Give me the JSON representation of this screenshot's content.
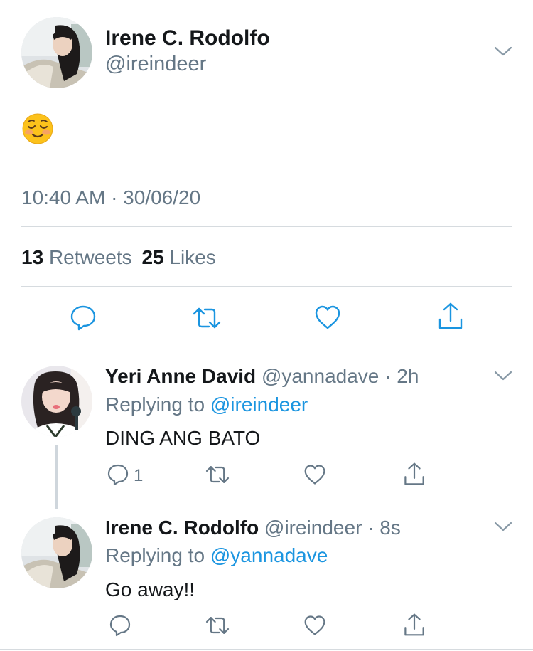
{
  "main_tweet": {
    "author_name": "Irene C. Rodolfo",
    "author_handle": "@ireindeer",
    "content_emoji": "☺️",
    "timestamp": "10:40 AM · 30/06/20",
    "retweets_count": "13",
    "retweets_label": "Retweets",
    "likes_count": "25",
    "likes_label": "Likes"
  },
  "replies": [
    {
      "author_name": "Yeri Anne David",
      "author_handle": "@yannadave",
      "time": "· 2h",
      "replying_prefix": "Replying to",
      "replying_to": "@ireindeer",
      "text": "DING ANG BATO",
      "reply_count": "1"
    },
    {
      "author_name": "Irene C. Rodolfo",
      "author_handle": "@ireindeer",
      "time": "· 8s",
      "replying_prefix": "Replying to",
      "replying_to": "@yannadave",
      "text": "Go away!!"
    }
  ],
  "colors": {
    "text": "#14171a",
    "secondary": "#657786",
    "link": "#1b95e0",
    "divider": "#d6dbdf"
  },
  "icons": [
    "chevron-down-icon",
    "reply-icon",
    "retweet-icon",
    "like-icon",
    "share-icon",
    "smiling-emoji"
  ]
}
